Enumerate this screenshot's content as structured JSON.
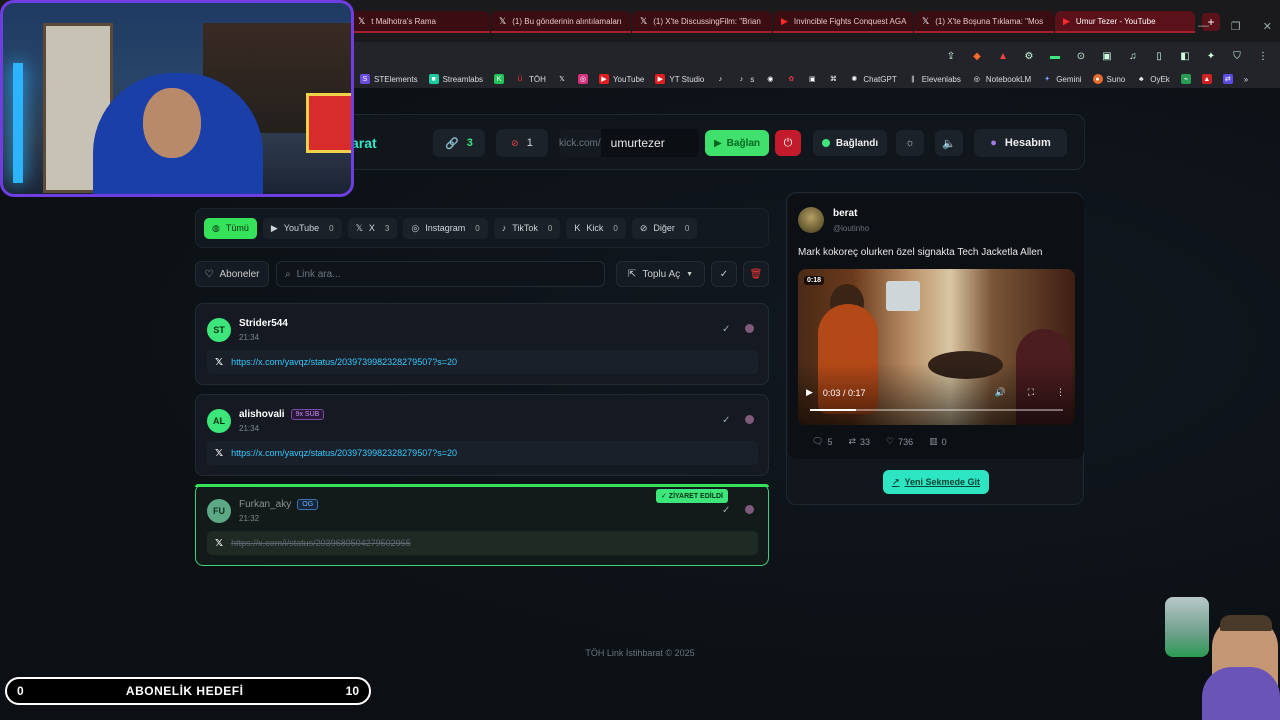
{
  "browser": {
    "tabs": [
      {
        "label": "t Malhotra's Rama",
        "icon": "x",
        "active": false
      },
      {
        "label": "(1) Bu gönderinin alıntılamaları",
        "icon": "x",
        "active": false
      },
      {
        "label": "(1) X'te DiscussingFilm: \"Brian",
        "icon": "x",
        "active": false
      },
      {
        "label": "Invincible Fights Conquest AGA",
        "icon": "youtube",
        "active": false
      },
      {
        "label": "(1) X'te Boşuna Tıklama: \"Mos",
        "icon": "x",
        "active": false
      },
      {
        "label": "Umur Tezer - YouTube",
        "icon": "youtube",
        "active": true
      }
    ],
    "new_tab": "+",
    "bookmarks": [
      "STElements",
      "Streamlabs",
      "",
      "TÖH",
      "",
      "",
      "YouTube",
      "YT Studio",
      "",
      "s",
      "",
      "",
      "",
      "",
      "ChatGPT",
      "Elevenlabs",
      "NotebookLM",
      "Gemini",
      "Suno",
      "OyEk",
      "",
      "",
      ""
    ]
  },
  "header": {
    "brand": "arat",
    "links_count": "3",
    "live_count": "1",
    "kick_prefix": "kick.com/",
    "kick_user": "umurtezer",
    "connect_label": "Bağlan",
    "status_label": "Bağlandı",
    "account_label": "Hesabım"
  },
  "filters": [
    {
      "label": "Tümü",
      "count": "",
      "icon": "globe",
      "active": true
    },
    {
      "label": "YouTube",
      "count": "0",
      "icon": "youtube"
    },
    {
      "label": "X",
      "count": "3",
      "icon": "x"
    },
    {
      "label": "Instagram",
      "count": "0",
      "icon": "instagram"
    },
    {
      "label": "TikTok",
      "count": "0",
      "icon": "tiktok"
    },
    {
      "label": "Kick",
      "count": "0",
      "icon": "kick"
    },
    {
      "label": "Diğer",
      "count": "0",
      "icon": "link"
    }
  ],
  "actions": {
    "follow_label": "Aboneler",
    "search_placeholder": "Link ara...",
    "bulk_label": "Toplu Aç"
  },
  "links": [
    {
      "initials": "ST",
      "user": "Strider544",
      "badge": "",
      "time": "21:34",
      "url": "https://x.com/yavqz/status/2039739982328279507?s=20",
      "visited": false
    },
    {
      "initials": "AL",
      "user": "alishovali",
      "badge": "9x SUB",
      "time": "21:34",
      "url": "https://x.com/yavqz/status/2039739982328279507?s=20",
      "visited": false
    },
    {
      "initials": "FU",
      "user": "Furkan_aky",
      "badge": "OG",
      "time": "21:32",
      "url": "https://x.com/i/status/2039680504279502965",
      "visited": true,
      "visited_label": "✓ ZİYARET EDİLDİ"
    }
  ],
  "preview": {
    "name": "berat",
    "handle": "@ioutinho",
    "text": "Mark kokoreç olurken özel signakta Tech Jacketla Allen",
    "video_badge": "0:18",
    "video_time": "0:03 / 0:17",
    "video_progress": 0.18,
    "replies": "5",
    "retweets": "33",
    "likes": "736",
    "views": "0",
    "open_label": "Yeni Sekmede Git"
  },
  "footer": "TÖH Link İstihbarat © 2025",
  "sub_goal": {
    "current": "0",
    "label": "ABONELİK HEDEFİ",
    "target": "10"
  },
  "colors": {
    "accent": "#3ce67a",
    "teal": "#2ee5c3",
    "link": "#35c9ff",
    "danger": "#c21b2b"
  }
}
